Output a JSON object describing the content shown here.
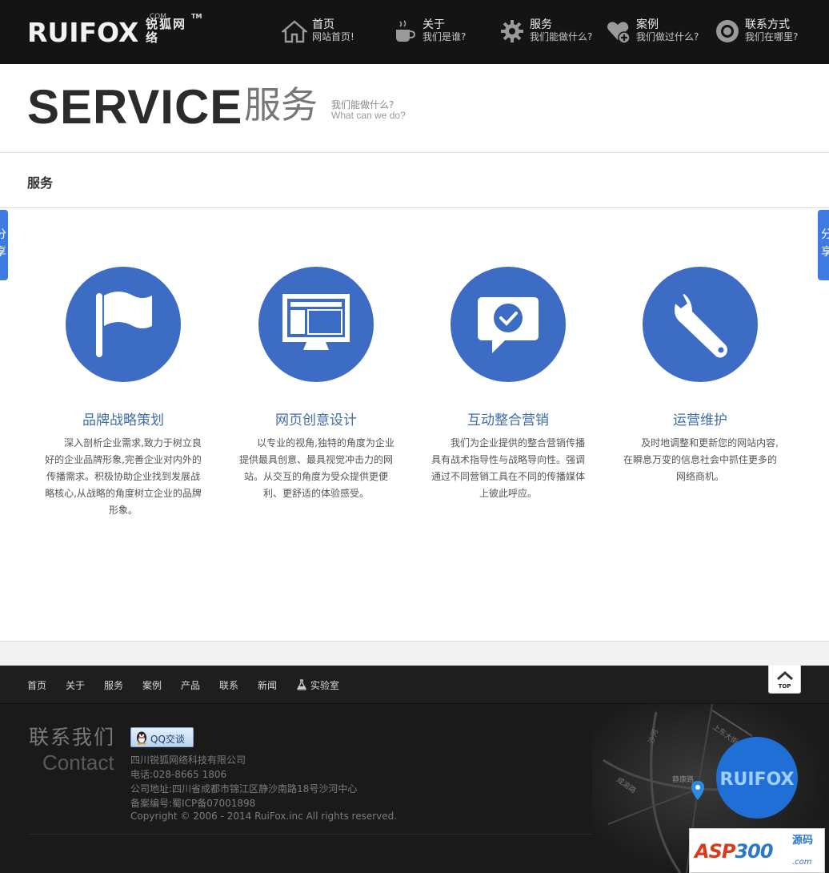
{
  "header": {
    "logo_text": "RUIFOX",
    "logo_cn": "锐狐网络",
    "logo_com": ".COM",
    "logo_tm": "TM",
    "nav": [
      {
        "title": "首页",
        "subtitle": "网站首页!",
        "icon": "home-icon"
      },
      {
        "title": "关于",
        "subtitle": "我们是谁?",
        "icon": "coffee-cup-icon"
      },
      {
        "title": "服务",
        "subtitle": "我们能做什么?",
        "icon": "gear-icon"
      },
      {
        "title": "案例",
        "subtitle": "我们做过什么?",
        "icon": "heart-plus-icon"
      },
      {
        "title": "联系方式",
        "subtitle": "我们在哪里?",
        "icon": "target-icon"
      }
    ]
  },
  "page_title": {
    "en": "SERVICE",
    "cn": "服务",
    "sub_cn": "我们能做什么?",
    "sub_en": "What can we do?"
  },
  "breadcrumb": "服务",
  "share": {
    "label": "分享"
  },
  "services": [
    {
      "title": "品牌战略策划",
      "icon": "flag-icon",
      "desc": "深入剖析企业需求,致力于树立良好的企业品牌形象,完善企业对内外的传播需求。积极协助企业找到发展战略核心,从战略的角度树立企业的品牌形象。"
    },
    {
      "title": "网页创意设计",
      "icon": "monitor-icon",
      "desc": "以专业的视角,独特的角度为企业提供最具创意、最具视觉冲击力的网站。从交互的角度为受众提供更便利、更舒适的体验感受。"
    },
    {
      "title": "互动整合营销",
      "icon": "chat-check-icon",
      "desc": "我们为企业提供的整合营销传播具有战术指导性与战略导向性。强调通过不同营销工具在不同的传播媒体上彼此呼应。"
    },
    {
      "title": "运营维护",
      "icon": "wrench-icon",
      "desc": "及时地调整和更新您的网站内容,在瞬息万变的信息社会中抓住更多的网络商机。"
    }
  ],
  "footer_nav": [
    "首页",
    "关于",
    "服务",
    "案例",
    "产品",
    "联系",
    "新闻",
    "实验室"
  ],
  "top_button": "TOP",
  "footer": {
    "contact_cn": "联系我们",
    "contact_en": "Contact",
    "qq_label": "QQ交谈",
    "company": "四川锐狐网络科技有限公司",
    "phone": "电话:028-8665 1806",
    "address": "公司地址:四川省成都市锦江区静沙南路18号沙河中心",
    "icp": "备案编号:蜀ICP备07001898",
    "copyright": "Copyright © 2006 - 2014 RuiFox.inc All rights reserved.",
    "map_brand": "RUIFOX",
    "map_roads": [
      "上东大街",
      "沙河",
      "静康路",
      "成渝路"
    ]
  },
  "watermark": {
    "asp": "ASP",
    "num": "300",
    "ym": "源码",
    "dot": ".com"
  },
  "colors": {
    "accent_blue": "#3d6cc4",
    "header_bg": "#141414",
    "share_blue": "#3d7be0"
  }
}
